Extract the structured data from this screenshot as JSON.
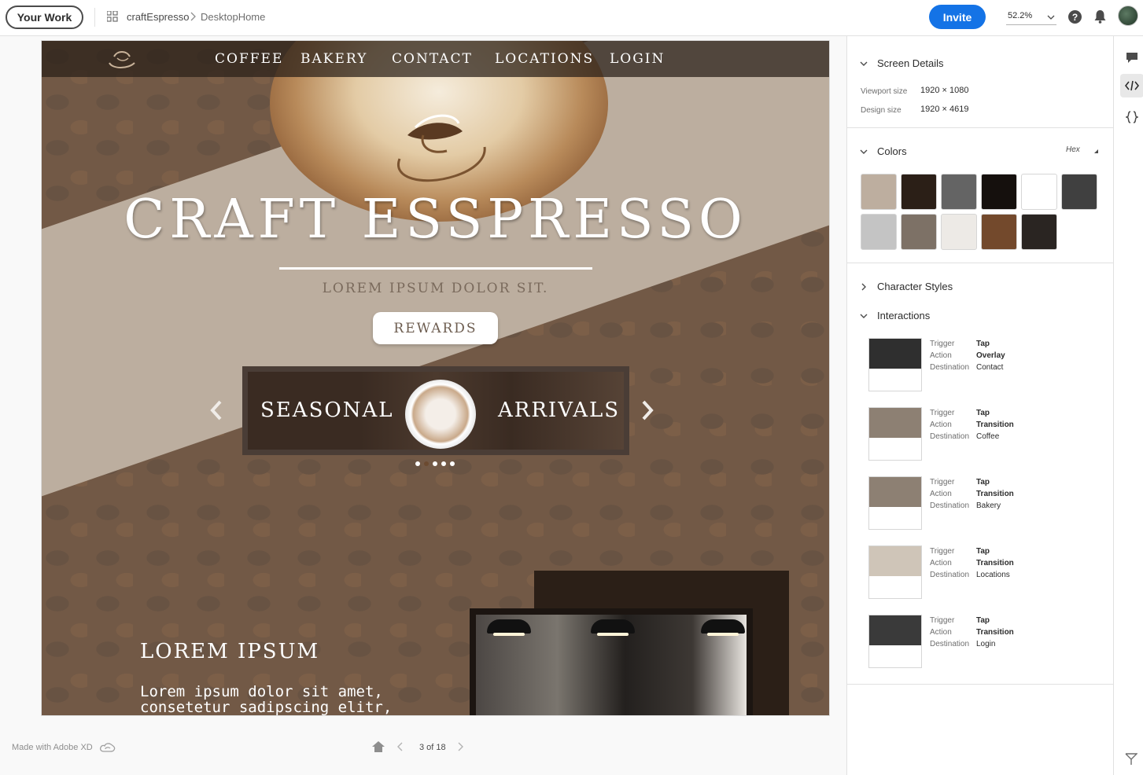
{
  "topbar": {
    "your_work": "Your Work",
    "project": "craftEspresso",
    "screen": "DesktopHome",
    "invite": "Invite",
    "zoom": "52.2%"
  },
  "site": {
    "nav": [
      "COFFEE",
      "BAKERY",
      "CONTACT",
      "LOCATIONS",
      "LOGIN"
    ],
    "hero_title": "CRAFT ESSPRESSO",
    "hero_subtitle": "LOREM IPSUM DOLOR SIT.",
    "rewards": "REWARDS",
    "carousel_left": "SEASONAL",
    "carousel_right": "ARRIVALS",
    "carousel_pages": 5,
    "carousel_active": 2,
    "section_title": "LOREM IPSUM",
    "section_body": "Lorem ipsum dolor sit amet, consetetur sadipscing elitr,"
  },
  "footer": {
    "made_with": "Made with Adobe XD",
    "page_count": "3 of 18"
  },
  "panel": {
    "screen_details": {
      "title": "Screen Details",
      "viewport_label": "Viewport size",
      "viewport_value": "1920 × 1080",
      "design_label": "Design size",
      "design_value": "1920 × 4619"
    },
    "colors": {
      "title": "Colors",
      "format": "Hex",
      "swatches": [
        "#BDAE9F",
        "#2B1F17",
        "#646464",
        "#15100D",
        "#FFFFFF",
        "#404040",
        "#C4C4C4",
        "#7D7166",
        "#EDEAE6",
        "#73492C",
        "#2A2522"
      ]
    },
    "character_styles": "Character Styles",
    "interactions": {
      "title": "Interactions",
      "labels": {
        "trigger": "Trigger",
        "action": "Action",
        "destination": "Destination"
      },
      "items": [
        {
          "trigger": "Tap",
          "action": "Overlay",
          "destination": "Contact"
        },
        {
          "trigger": "Tap",
          "action": "Transition",
          "destination": "Coffee"
        },
        {
          "trigger": "Tap",
          "action": "Transition",
          "destination": "Bakery"
        },
        {
          "trigger": "Tap",
          "action": "Transition",
          "destination": "Locations"
        },
        {
          "trigger": "Tap",
          "action": "Transition",
          "destination": "Login"
        }
      ]
    }
  }
}
